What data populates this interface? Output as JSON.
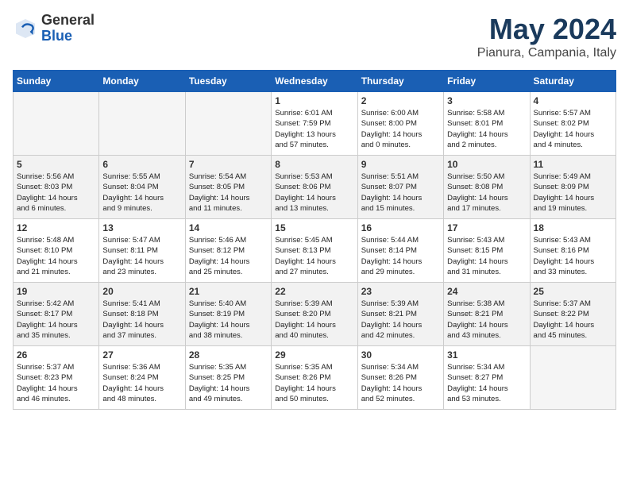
{
  "header": {
    "logo_general": "General",
    "logo_blue": "Blue",
    "month": "May 2024",
    "location": "Pianura, Campania, Italy"
  },
  "weekdays": [
    "Sunday",
    "Monday",
    "Tuesday",
    "Wednesday",
    "Thursday",
    "Friday",
    "Saturday"
  ],
  "weeks": [
    [
      {
        "day": "",
        "text": ""
      },
      {
        "day": "",
        "text": ""
      },
      {
        "day": "",
        "text": ""
      },
      {
        "day": "1",
        "text": "Sunrise: 6:01 AM\nSunset: 7:59 PM\nDaylight: 13 hours\nand 57 minutes."
      },
      {
        "day": "2",
        "text": "Sunrise: 6:00 AM\nSunset: 8:00 PM\nDaylight: 14 hours\nand 0 minutes."
      },
      {
        "day": "3",
        "text": "Sunrise: 5:58 AM\nSunset: 8:01 PM\nDaylight: 14 hours\nand 2 minutes."
      },
      {
        "day": "4",
        "text": "Sunrise: 5:57 AM\nSunset: 8:02 PM\nDaylight: 14 hours\nand 4 minutes."
      }
    ],
    [
      {
        "day": "5",
        "text": "Sunrise: 5:56 AM\nSunset: 8:03 PM\nDaylight: 14 hours\nand 6 minutes."
      },
      {
        "day": "6",
        "text": "Sunrise: 5:55 AM\nSunset: 8:04 PM\nDaylight: 14 hours\nand 9 minutes."
      },
      {
        "day": "7",
        "text": "Sunrise: 5:54 AM\nSunset: 8:05 PM\nDaylight: 14 hours\nand 11 minutes."
      },
      {
        "day": "8",
        "text": "Sunrise: 5:53 AM\nSunset: 8:06 PM\nDaylight: 14 hours\nand 13 minutes."
      },
      {
        "day": "9",
        "text": "Sunrise: 5:51 AM\nSunset: 8:07 PM\nDaylight: 14 hours\nand 15 minutes."
      },
      {
        "day": "10",
        "text": "Sunrise: 5:50 AM\nSunset: 8:08 PM\nDaylight: 14 hours\nand 17 minutes."
      },
      {
        "day": "11",
        "text": "Sunrise: 5:49 AM\nSunset: 8:09 PM\nDaylight: 14 hours\nand 19 minutes."
      }
    ],
    [
      {
        "day": "12",
        "text": "Sunrise: 5:48 AM\nSunset: 8:10 PM\nDaylight: 14 hours\nand 21 minutes."
      },
      {
        "day": "13",
        "text": "Sunrise: 5:47 AM\nSunset: 8:11 PM\nDaylight: 14 hours\nand 23 minutes."
      },
      {
        "day": "14",
        "text": "Sunrise: 5:46 AM\nSunset: 8:12 PM\nDaylight: 14 hours\nand 25 minutes."
      },
      {
        "day": "15",
        "text": "Sunrise: 5:45 AM\nSunset: 8:13 PM\nDaylight: 14 hours\nand 27 minutes."
      },
      {
        "day": "16",
        "text": "Sunrise: 5:44 AM\nSunset: 8:14 PM\nDaylight: 14 hours\nand 29 minutes."
      },
      {
        "day": "17",
        "text": "Sunrise: 5:43 AM\nSunset: 8:15 PM\nDaylight: 14 hours\nand 31 minutes."
      },
      {
        "day": "18",
        "text": "Sunrise: 5:43 AM\nSunset: 8:16 PM\nDaylight: 14 hours\nand 33 minutes."
      }
    ],
    [
      {
        "day": "19",
        "text": "Sunrise: 5:42 AM\nSunset: 8:17 PM\nDaylight: 14 hours\nand 35 minutes."
      },
      {
        "day": "20",
        "text": "Sunrise: 5:41 AM\nSunset: 8:18 PM\nDaylight: 14 hours\nand 37 minutes."
      },
      {
        "day": "21",
        "text": "Sunrise: 5:40 AM\nSunset: 8:19 PM\nDaylight: 14 hours\nand 38 minutes."
      },
      {
        "day": "22",
        "text": "Sunrise: 5:39 AM\nSunset: 8:20 PM\nDaylight: 14 hours\nand 40 minutes."
      },
      {
        "day": "23",
        "text": "Sunrise: 5:39 AM\nSunset: 8:21 PM\nDaylight: 14 hours\nand 42 minutes."
      },
      {
        "day": "24",
        "text": "Sunrise: 5:38 AM\nSunset: 8:21 PM\nDaylight: 14 hours\nand 43 minutes."
      },
      {
        "day": "25",
        "text": "Sunrise: 5:37 AM\nSunset: 8:22 PM\nDaylight: 14 hours\nand 45 minutes."
      }
    ],
    [
      {
        "day": "26",
        "text": "Sunrise: 5:37 AM\nSunset: 8:23 PM\nDaylight: 14 hours\nand 46 minutes."
      },
      {
        "day": "27",
        "text": "Sunrise: 5:36 AM\nSunset: 8:24 PM\nDaylight: 14 hours\nand 48 minutes."
      },
      {
        "day": "28",
        "text": "Sunrise: 5:35 AM\nSunset: 8:25 PM\nDaylight: 14 hours\nand 49 minutes."
      },
      {
        "day": "29",
        "text": "Sunrise: 5:35 AM\nSunset: 8:26 PM\nDaylight: 14 hours\nand 50 minutes."
      },
      {
        "day": "30",
        "text": "Sunrise: 5:34 AM\nSunset: 8:26 PM\nDaylight: 14 hours\nand 52 minutes."
      },
      {
        "day": "31",
        "text": "Sunrise: 5:34 AM\nSunset: 8:27 PM\nDaylight: 14 hours\nand 53 minutes."
      },
      {
        "day": "",
        "text": ""
      }
    ]
  ]
}
